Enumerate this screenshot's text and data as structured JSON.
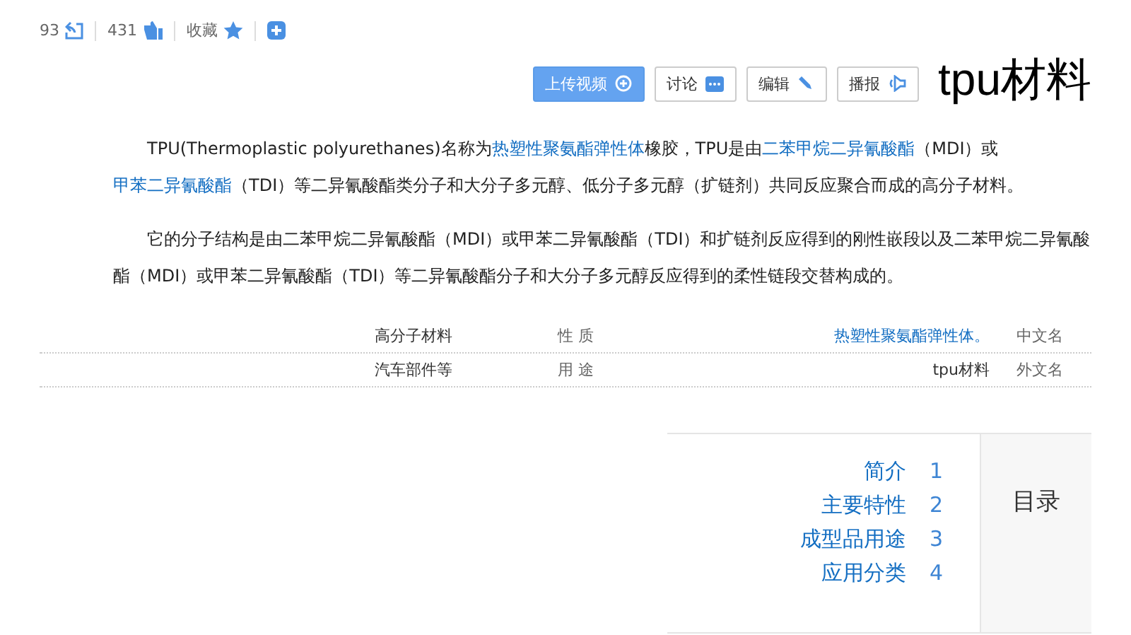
{
  "title": "tpu材料",
  "actions": [
    {
      "kind": "upload",
      "label": "上传视频"
    },
    {
      "kind": "discuss",
      "label": "讨论"
    },
    {
      "kind": "edit",
      "label": "编辑"
    },
    {
      "kind": "speak",
      "label": "播报"
    }
  ],
  "stats": [
    {
      "kind": "share",
      "label": "93"
    },
    {
      "kind": "like",
      "label": "431"
    },
    {
      "kind": "favorite",
      "label": "收藏"
    },
    {
      "kind": "add"
    }
  ],
  "paragraphs": [
    [
      {
        "text": "TPU(Thermoplastic polyurethanes)名称为",
        "link": false
      },
      {
        "text": "热塑性聚氨酯弹性体",
        "link": true
      },
      {
        "text": "橡胶，TPU是由",
        "link": false
      },
      {
        "text": "二苯甲烷二异氰酸酯",
        "link": true
      },
      {
        "text": "（MDI）或",
        "link": false
      },
      {
        "text": "甲苯二异氰酸酯",
        "link": true
      },
      {
        "text": "（TDI）等二异氰酸酯类分子和大分子多元醇、低分子多元醇（扩链剂）共同反应聚合而成的高分子材料。",
        "link": false
      }
    ],
    [
      {
        "text": "它的分子结构是由二苯甲烷二异氰酸酯（MDI）或甲苯二异氰酸酯（TDI）和扩链剂反应得到的刚性嵌段以及二苯甲烷二异氰酸酯（MDI）或甲苯二异氰酸酯（TDI）等二异氰酸酯分子和大分子多元醇反应得到的柔性链段交替构成的。",
        "link": false
      }
    ]
  ],
  "info": [
    {
      "name": "性 质",
      "value": "高分子材料",
      "link": false
    },
    {
      "name": "中文名",
      "value": "热塑性聚氨酯弹性体。",
      "link": true
    },
    {
      "name": "用 途",
      "value": "汽车部件等",
      "link": false
    },
    {
      "name": "外文名",
      "value": "tpu材料",
      "link": false
    }
  ],
  "toc": {
    "label": "目录",
    "items": [
      {
        "number": "1",
        "text": "简介"
      },
      {
        "number": "2",
        "text": "主要特性"
      },
      {
        "number": "3",
        "text": "成型品用途"
      },
      {
        "number": "4",
        "text": "应用分类"
      }
    ]
  }
}
